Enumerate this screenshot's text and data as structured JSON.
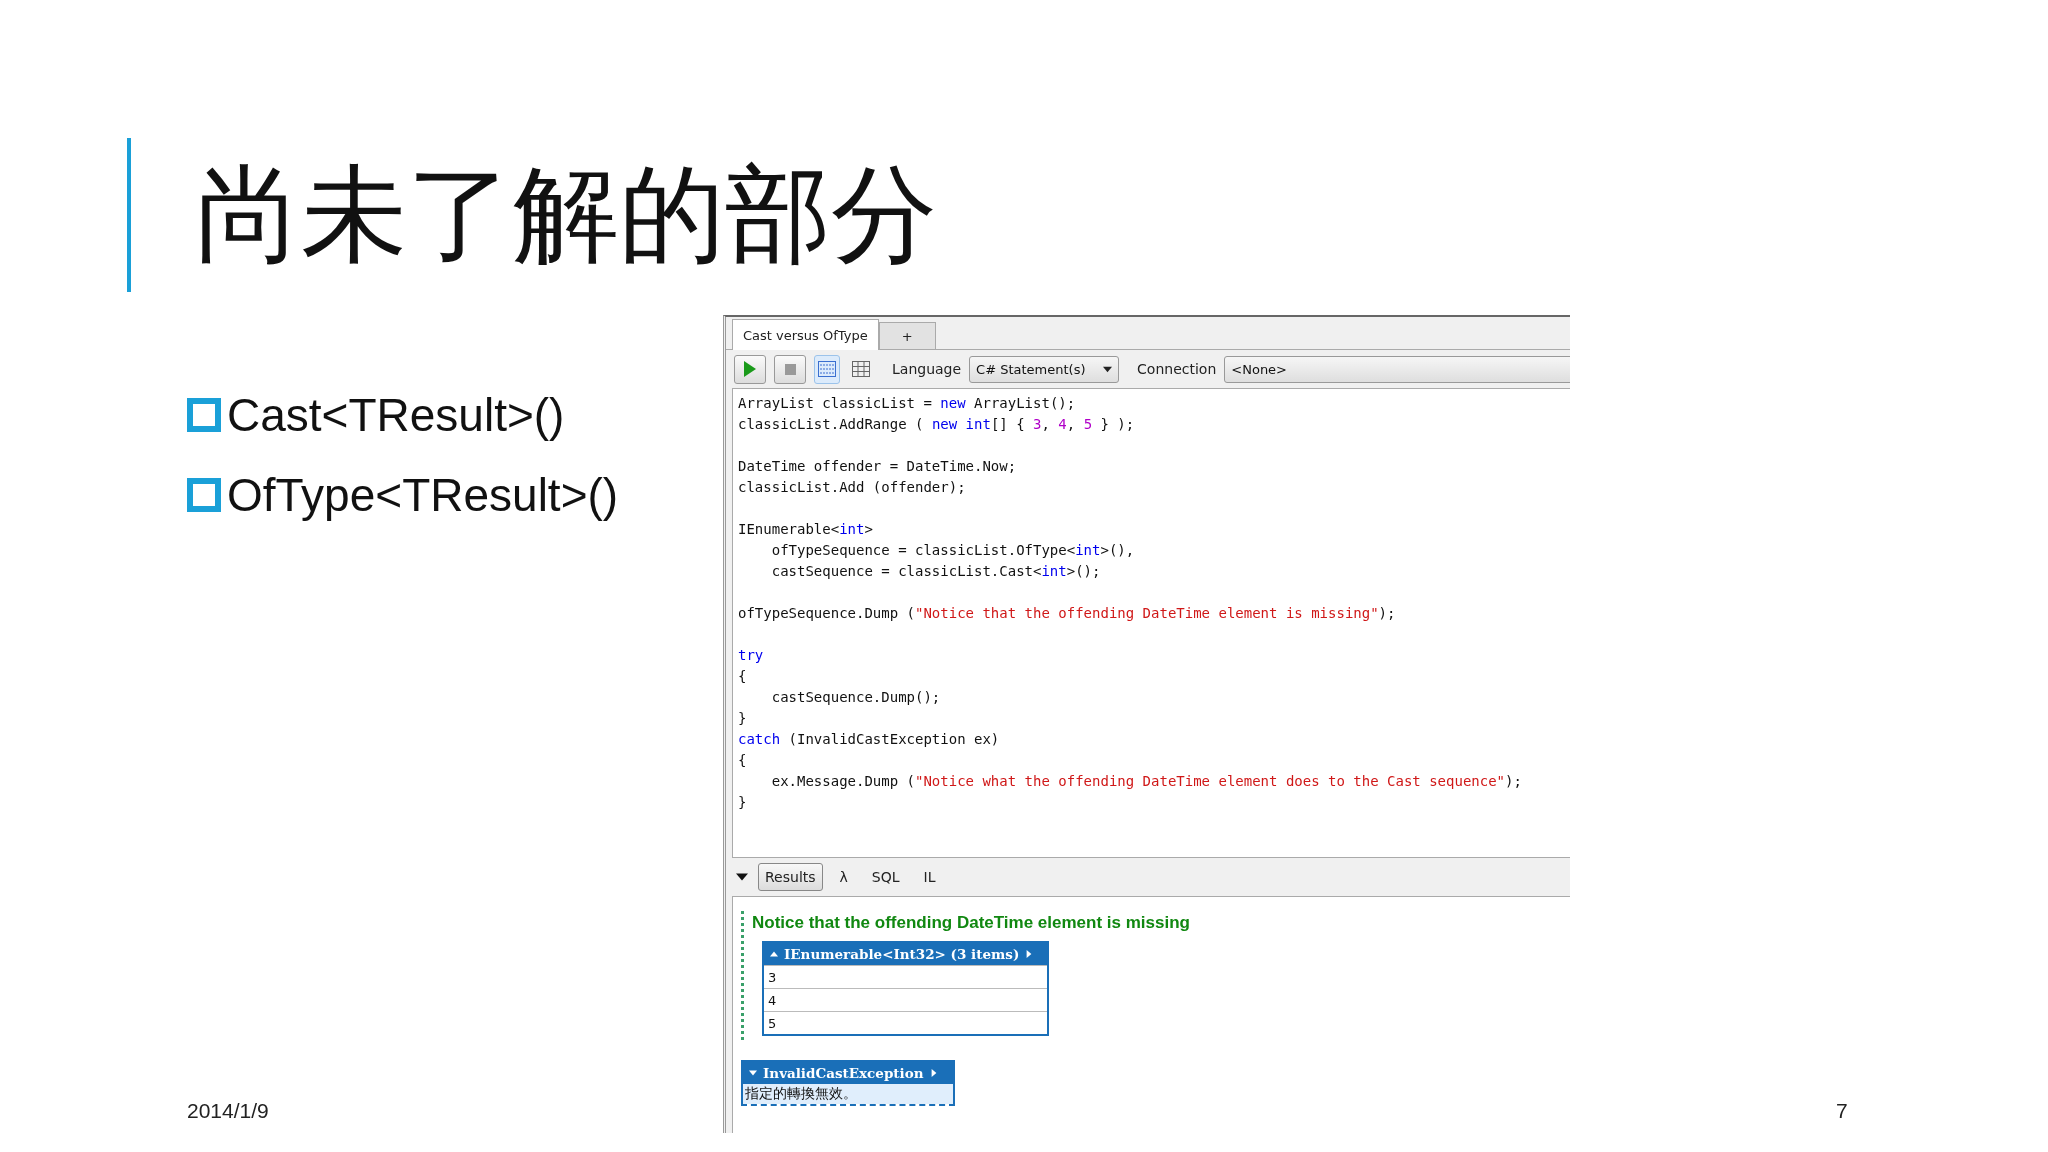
{
  "title": "尚未了解的部分",
  "bullets": [
    "Cast<TResult>()",
    "OfType<TResult>()"
  ],
  "screenshot": {
    "tabs": [
      {
        "label": "Cast versus OfType",
        "selected": true
      },
      {
        "label": "+",
        "selected": false
      }
    ],
    "toolbar": {
      "buttons": [
        {
          "kind": "run"
        },
        {
          "kind": "stop"
        },
        {
          "kind": "text_view",
          "selected": true
        },
        {
          "kind": "grid_view",
          "selected": false
        }
      ],
      "language": {
        "label": "Language",
        "value": "C# Statement(s)"
      },
      "connection": {
        "label": "Connection",
        "value": "<None>"
      }
    },
    "code_blocks": [
      {
        "lines": [
          [
            {
              "kind": "plain",
              "text": "ArrayList classicList = "
            },
            {
              "kind": "keyword",
              "text": "new"
            },
            {
              "kind": "plain",
              "text": " ArrayList();"
            }
          ],
          [
            {
              "kind": "plain",
              "text": "classicList.AddRange ( "
            },
            {
              "kind": "keyword",
              "text": "new int"
            },
            {
              "kind": "plain",
              "text": "[] { "
            },
            {
              "kind": "number",
              "text": "3"
            },
            {
              "kind": "plain",
              "text": ", "
            },
            {
              "kind": "number",
              "text": "4"
            },
            {
              "kind": "plain",
              "text": ", "
            },
            {
              "kind": "number",
              "text": "5"
            },
            {
              "kind": "plain",
              "text": " } );"
            }
          ]
        ]
      },
      {
        "lines": [
          [
            {
              "kind": "plain",
              "text": "DateTime offender = DateTime.Now;"
            }
          ],
          [
            {
              "kind": "plain",
              "text": "classicList.Add (offender);"
            }
          ]
        ]
      },
      {
        "lines": [
          [
            {
              "kind": "plain",
              "text": "IEnumerable<"
            },
            {
              "kind": "keyword",
              "text": "int"
            },
            {
              "kind": "plain",
              "text": ">"
            }
          ],
          [
            {
              "kind": "plain",
              "text": "    ofTypeSequence = classicList.OfType<"
            },
            {
              "kind": "keyword",
              "text": "int"
            },
            {
              "kind": "plain",
              "text": ">(),"
            }
          ],
          [
            {
              "kind": "plain",
              "text": "    castSequence = classicList.Cast<"
            },
            {
              "kind": "keyword",
              "text": "int"
            },
            {
              "kind": "plain",
              "text": ">();"
            }
          ]
        ]
      },
      {
        "lines": [
          [
            {
              "kind": "plain",
              "text": "ofTypeSequence.Dump ("
            },
            {
              "kind": "string",
              "text": "\"Notice that the offending DateTime element is missing\""
            },
            {
              "kind": "plain",
              "text": ");"
            }
          ]
        ]
      },
      {
        "lines": [
          [
            {
              "kind": "keyword",
              "text": "try"
            }
          ],
          [
            {
              "kind": "plain",
              "text": "{"
            }
          ],
          [
            {
              "kind": "plain",
              "text": "    castSequence.Dump();"
            }
          ],
          [
            {
              "kind": "plain",
              "text": "}"
            }
          ],
          [
            {
              "kind": "keyword",
              "text": "catch"
            },
            {
              "kind": "plain",
              "text": " (InvalidCastException ex)"
            }
          ],
          [
            {
              "kind": "plain",
              "text": "{"
            }
          ],
          [
            {
              "kind": "plain",
              "text": "    ex.Message.Dump ("
            },
            {
              "kind": "string",
              "text": "\"Notice what the offending DateTime element does to the Cast sequence\""
            },
            {
              "kind": "plain",
              "text": ");"
            }
          ],
          [
            {
              "kind": "plain",
              "text": "}"
            }
          ]
        ]
      }
    ],
    "results_tabs": [
      {
        "label": "Results",
        "selected": true
      },
      {
        "label": "λ",
        "selected": false
      },
      {
        "label": "SQL",
        "selected": false
      },
      {
        "label": "IL",
        "selected": false
      }
    ],
    "output": {
      "heading": "Notice that the offending DateTime element is missing",
      "table": {
        "header": "IEnumerable<Int32> (3 items)",
        "rows": [
          "3",
          "4",
          "5"
        ]
      },
      "exception": {
        "header": "InvalidCastException",
        "message": "指定的轉換無效。"
      }
    }
  },
  "footer": {
    "date": "2014/1/9",
    "page": "7"
  }
}
